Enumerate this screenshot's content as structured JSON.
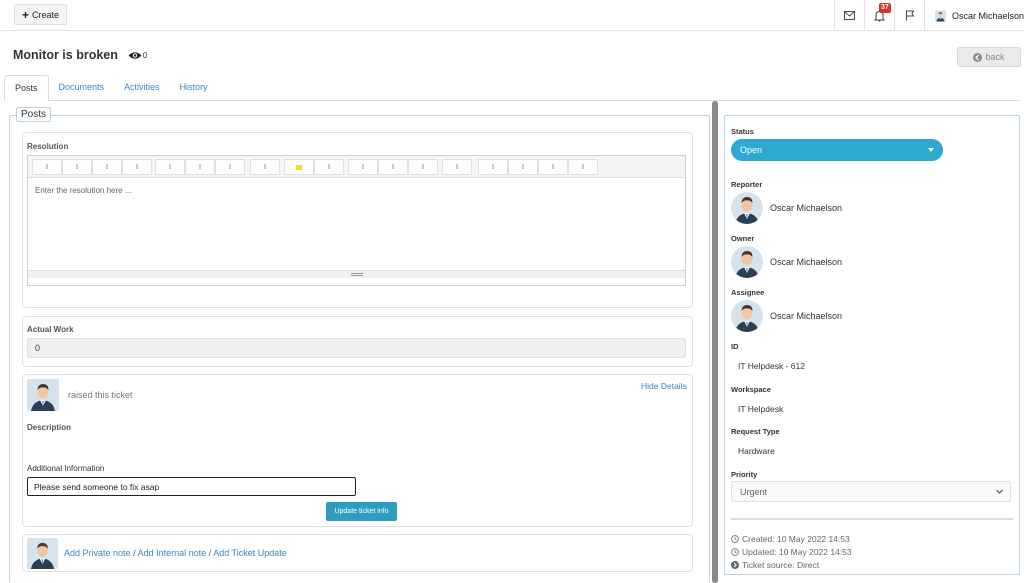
{
  "topbar": {
    "create_label": "Create",
    "notification_count": "37",
    "user_name": "Oscar Michaelson"
  },
  "ticket": {
    "title": "Monitor is broken",
    "watchers": "0",
    "back_label": "back"
  },
  "tabs": [
    {
      "label": "Posts",
      "active": true
    },
    {
      "label": "Documents",
      "active": false
    },
    {
      "label": "Activities",
      "active": false
    },
    {
      "label": "History",
      "active": false
    }
  ],
  "posts": {
    "legend": "Posts",
    "resolution_label": "Resolution",
    "resolution_placeholder": "Enter the resolution here ...",
    "actual_work_label": "Actual Work",
    "actual_work_value": "0",
    "raised_text": "raised this ticket",
    "hide_details": "Hide Details",
    "description_label": "Description",
    "additional_info_label": "Additional Information",
    "additional_info_value": "Please send someone to fix asap",
    "update_button": "Update ticket info",
    "add_private_note": "Add Private note",
    "add_internal_note": "Add Internal note",
    "add_ticket_update": "Add Ticket Update",
    "sep": "/"
  },
  "sidebar": {
    "status_label": "Status",
    "status_value": "Open",
    "reporter_label": "Reporter",
    "reporter_name": "Oscar Michaelson",
    "owner_label": "Owner",
    "owner_name": "Oscar Michaelson",
    "assignee_label": "Assignee",
    "assignee_name": "Oscar Michaelson",
    "id_label": "ID",
    "id_value": "IT Helpdesk - 612",
    "workspace_label": "Workspace",
    "workspace_value": "IT Helpdesk",
    "request_type_label": "Request Type",
    "request_type_value": "Hardware",
    "priority_label": "Priority",
    "priority_value": "Urgent",
    "created": "Created: 10 May 2022 14:53",
    "updated": "Updated: 10 May 2022 14:53",
    "ticket_source": "Ticket source:  Direct"
  },
  "colors": {
    "accent": "#2fa9d1",
    "link": "#3a86c8",
    "badge": "#d9342b"
  }
}
